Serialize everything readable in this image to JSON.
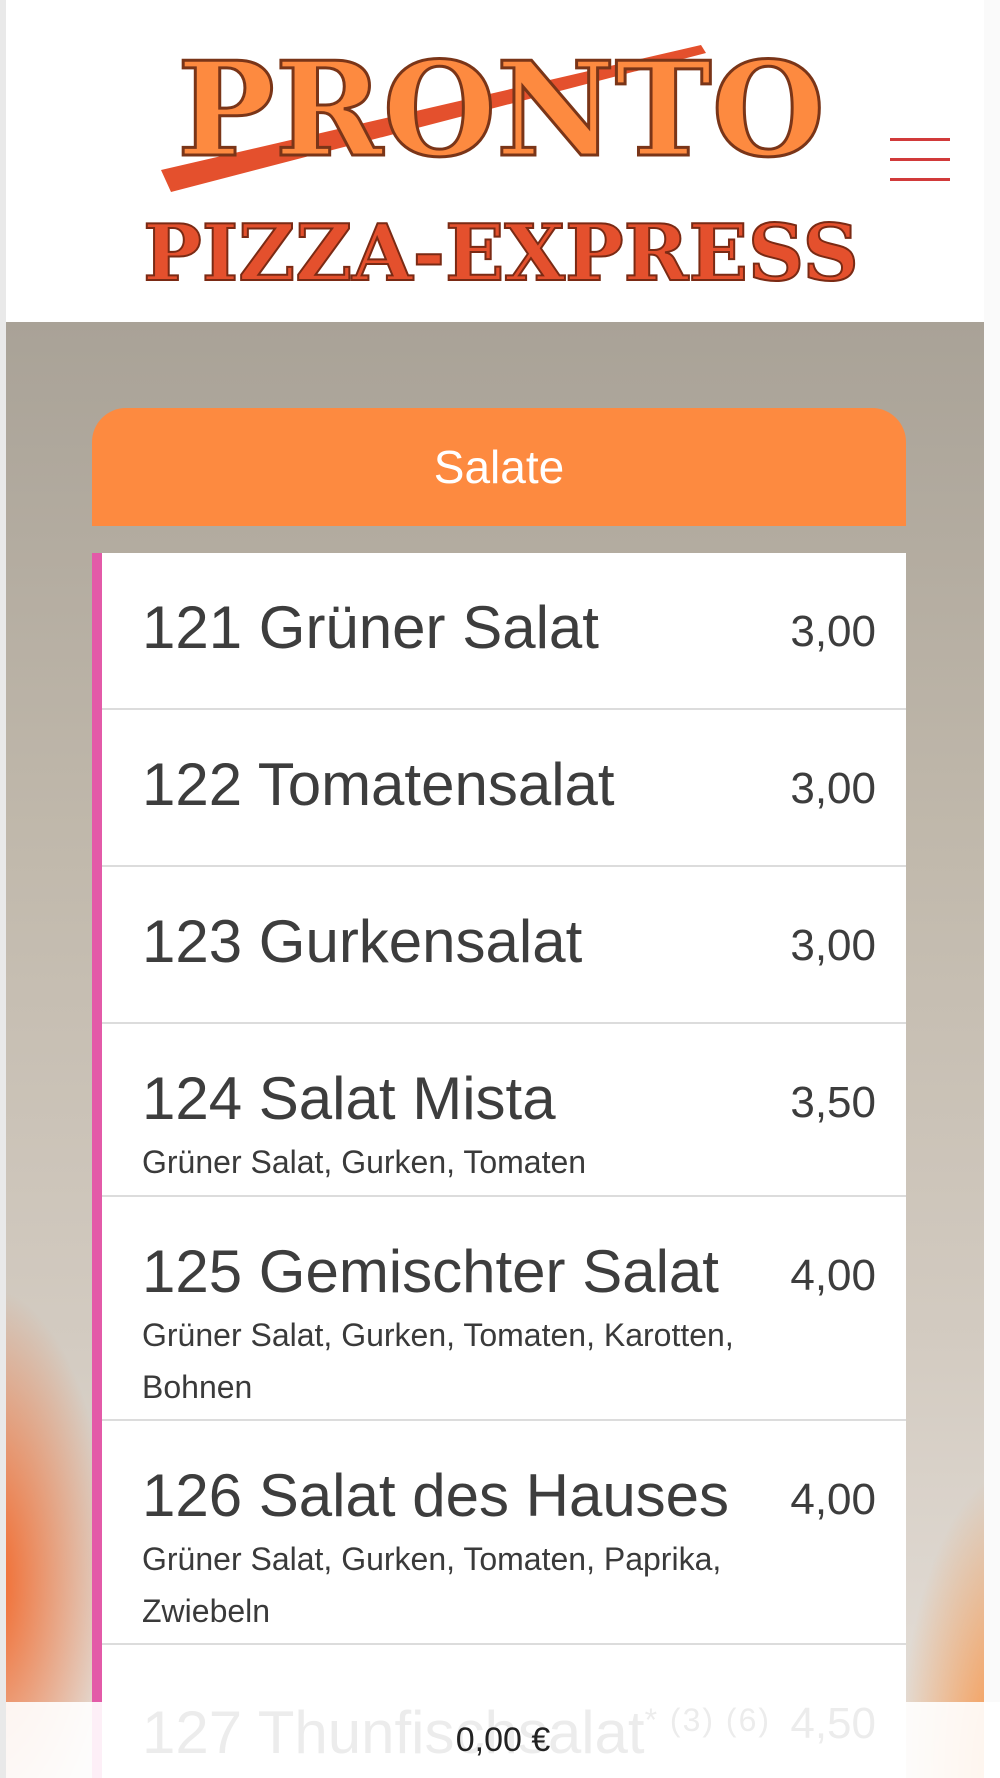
{
  "brand": {
    "logo_line1": "PRONTO",
    "logo_line2": "PIZZA-EXPRESS",
    "colors": {
      "logo_orange": "#fd8a40",
      "logo_red": "#e4502d",
      "menu_icon": "#d13a3a",
      "accent_stripe": "#e35aa8"
    }
  },
  "header": {
    "menu_icon": "hamburger-icon"
  },
  "category": {
    "title": "Salate"
  },
  "items": [
    {
      "number": "121",
      "name": "Grüner Salat",
      "price": "3,00",
      "description": ""
    },
    {
      "number": "122",
      "name": "Tomatensalat",
      "price": "3,00",
      "description": ""
    },
    {
      "number": "123",
      "name": "Gurkensalat",
      "price": "3,00",
      "description": ""
    },
    {
      "number": "124",
      "name": "Salat Mista",
      "price": "3,50",
      "description": "Grüner Salat, Gurken, Tomaten"
    },
    {
      "number": "125",
      "name": "Gemischter Salat",
      "price": "4,00",
      "description": "Grüner Salat, Gurken, Tomaten, Karotten, Bohnen"
    },
    {
      "number": "126",
      "name": "Salat des Hauses",
      "price": "4,00",
      "description": "Grüner Salat, Gurken, Tomaten, Paprika, Zwiebeln"
    },
    {
      "number": "127",
      "name": "Thunfischsalat",
      "price": "4,50",
      "description": "",
      "footnote": "* (3) (6)"
    }
  ],
  "cart": {
    "total": "0,00 €"
  }
}
